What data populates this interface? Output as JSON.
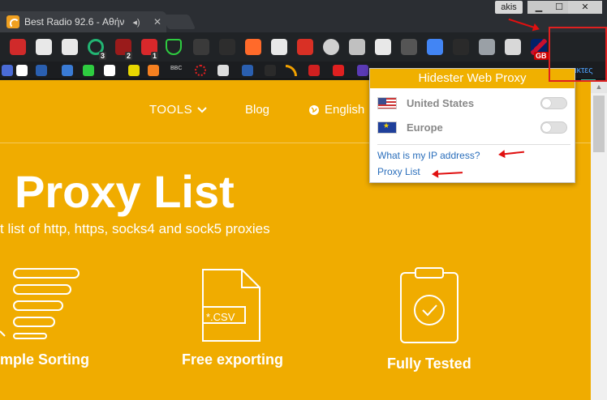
{
  "window": {
    "tab_title": "Best Radio 92.6 - Αθήν",
    "user_name": "akis",
    "minimize_glyph": "▁",
    "maximize_glyph": "☐",
    "close_glyph": "✕",
    "speaker_glyph": "◂)",
    "tab_close_glyph": "✕"
  },
  "extensions": {
    "row1_badges": [
      "3",
      "2",
      "1"
    ],
    "gb_badge": "GB",
    "bbc_label": "BBC",
    "hidester_letter": "H",
    "partial_right_text": "ικτες"
  },
  "nav": {
    "tools_label": "TOOLS",
    "blog_label": "Blog",
    "language_label": "English"
  },
  "hero": {
    "title": "Proxy List",
    "subtitle": "t list of http, https, socks4 and sock5 proxies"
  },
  "features": [
    {
      "label": "mple Sorting"
    },
    {
      "label": "Free exporting",
      "file_tag": "*.CSV"
    },
    {
      "label": "Fully Tested"
    }
  ],
  "popup": {
    "title": "Hidester Web Proxy",
    "locations": [
      {
        "name": "United States",
        "enabled": false
      },
      {
        "name": "Europe",
        "enabled": false
      }
    ],
    "links": [
      "What is my IP address?",
      "Proxy List"
    ]
  },
  "colors": {
    "brand_orange": "#f0ac00",
    "popup_header": "#f0b000",
    "annotation_red": "#e01010",
    "link_blue": "#2a6ebb"
  }
}
